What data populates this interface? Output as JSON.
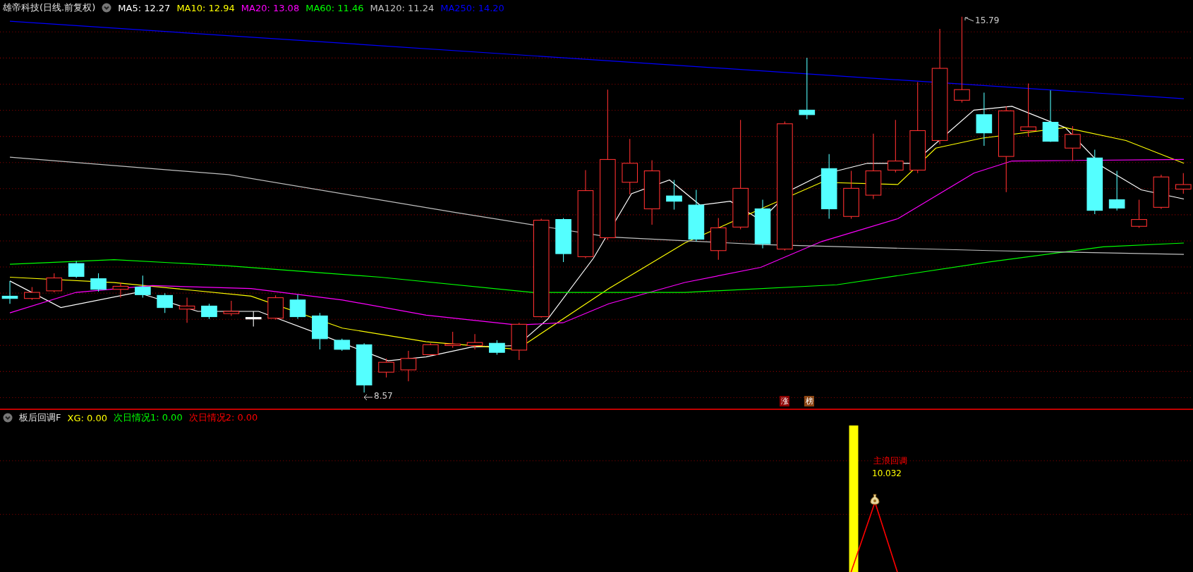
{
  "header": {
    "title": "雄帝科技(日线.前复权)",
    "indicators": [
      {
        "label": "MA5: 12.27",
        "color": "#ffffff"
      },
      {
        "label": "MA10: 12.94",
        "color": "#ffff00"
      },
      {
        "label": "MA20: 13.08",
        "color": "#ff00ff"
      },
      {
        "label": "MA60: 11.46",
        "color": "#00ff00"
      },
      {
        "label": "MA120: 11.24",
        "color": "#c0c0c0"
      },
      {
        "label": "MA250: 14.20",
        "color": "#0000ff"
      }
    ]
  },
  "main_chart": {
    "high_label": "15.79",
    "low_label": "8.57",
    "badges": [
      {
        "text": "涨",
        "color": "#8b0000"
      },
      {
        "text": "榜",
        "color": "#8b4513"
      }
    ]
  },
  "sub_chart": {
    "title": "板后回调F",
    "indicators": [
      {
        "label": "XG: 0.00",
        "color": "#ffff00"
      },
      {
        "label": "次日情况1: 0.00",
        "color": "#00ff00"
      },
      {
        "label": "次日情况2: 0.00",
        "color": "#ff0000"
      }
    ],
    "signal_label": "主浪回调",
    "signal_value": "10.032"
  }
}
